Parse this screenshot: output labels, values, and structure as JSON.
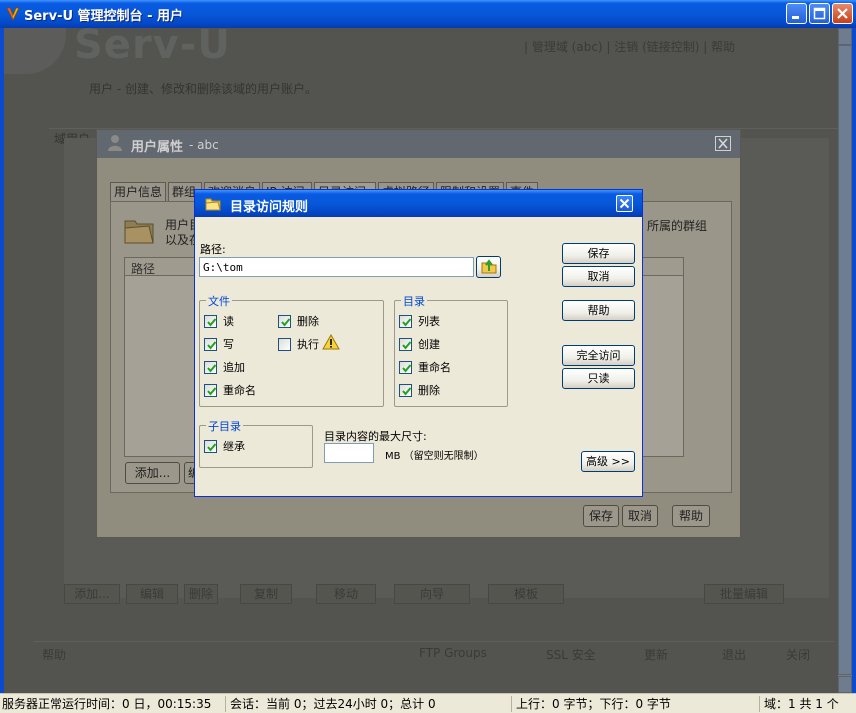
{
  "window": {
    "title": "Serv-U 管理控制台 - 用户"
  },
  "background_app": {
    "logo": "Serv-U",
    "nav": "| 管理域 (abc)   |   注销   (链接控制)   |   帮助",
    "description": "用户 - 创建、修改和删除该域的用户账户。",
    "user_label": "域用户",
    "bottom_buttons": [
      "添加...",
      "编辑",
      "删除",
      "复制",
      "移动",
      "向导",
      "模板",
      "批量编辑"
    ],
    "footer_items": [
      "帮助",
      "FTP Groups",
      "SSL 安全",
      "更新",
      "退出",
      "关闭"
    ]
  },
  "user_properties": {
    "title": "用户属性",
    "subtitle": "- abc",
    "tabs": [
      "用户信息",
      "群组",
      "欢迎消息",
      "IP 访问",
      "目录访问",
      "虚拟路径",
      "限制和设置",
      "事件"
    ],
    "text_line1": "用户目",
    "text_line2": "以及在",
    "text_right": "所属的群组",
    "list_column": "路径",
    "buttons": {
      "add": "添加...",
      "edit": "编",
      "save": "保存",
      "cancel": "取消",
      "help": "帮助"
    }
  },
  "dialog": {
    "title": "目录访问规则",
    "path_label": "路径:",
    "path_value": "G:\\tom",
    "buttons": {
      "save": "保存",
      "cancel": "取消",
      "help": "帮助",
      "full_access": "完全访问",
      "read_only": "只读",
      "advanced": "高级 >>"
    },
    "files_group": {
      "title": "文件",
      "items": [
        {
          "label": "读",
          "checked": true
        },
        {
          "label": "写",
          "checked": true
        },
        {
          "label": "追加",
          "checked": true
        },
        {
          "label": "重命名",
          "checked": true
        },
        {
          "label": "删除",
          "checked": true
        },
        {
          "label": "执行",
          "checked": false
        }
      ]
    },
    "dirs_group": {
      "title": "目录",
      "items": [
        {
          "label": "列表",
          "checked": true
        },
        {
          "label": "创建",
          "checked": true
        },
        {
          "label": "重命名",
          "checked": true
        },
        {
          "label": "删除",
          "checked": true
        }
      ]
    },
    "subdir_group": {
      "title": "子目录",
      "items": [
        {
          "label": "继承",
          "checked": true
        }
      ]
    },
    "max_size_label": "目录内容的最大尺寸:",
    "max_size_value": "",
    "max_size_unit": "MB （留空则无限制）"
  },
  "statusbar": {
    "uptime": "服务器正常运行时间：0 日，00:15:35",
    "sessions": "会话：当前 0；过去24小时 0；总计 0",
    "transfer": "上行：0 字节；下行：0 字节",
    "domains": "域：1 共 1 个"
  }
}
